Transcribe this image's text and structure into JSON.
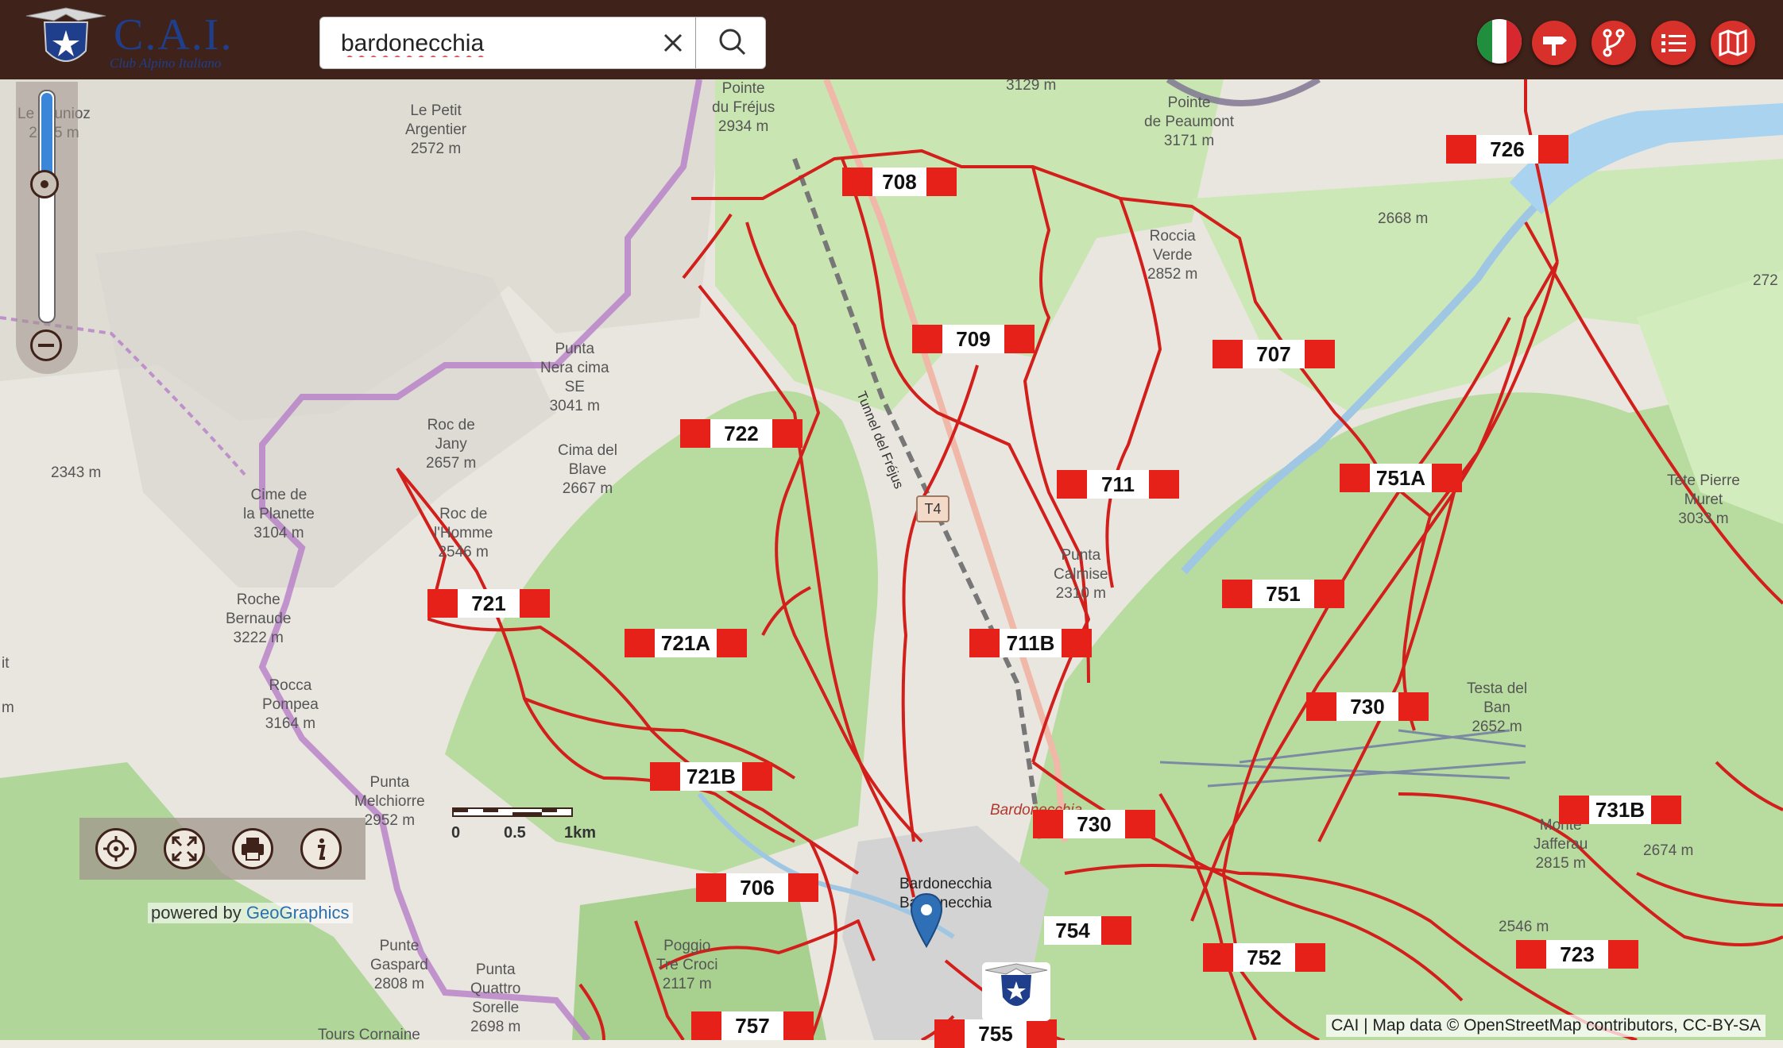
{
  "header": {
    "logo_title": "C.A.I.",
    "logo_subtitle": "Club Alpino Italiano",
    "search_value": "bardonecchia",
    "language": "it",
    "toolbar_icons": [
      "flag-italy-icon",
      "signpost-icon",
      "fork-route-icon",
      "list-icon",
      "map-icon"
    ],
    "accent": "#d8312b",
    "bar_color": "#3f2219"
  },
  "routes": [
    {
      "id": "708"
    },
    {
      "id": "726"
    },
    {
      "id": "709"
    },
    {
      "id": "707"
    },
    {
      "id": "722"
    },
    {
      "id": "711"
    },
    {
      "id": "751A"
    },
    {
      "id": "751"
    },
    {
      "id": "721"
    },
    {
      "id": "721A"
    },
    {
      "id": "711B"
    },
    {
      "id": "730"
    },
    {
      "id": "730"
    },
    {
      "id": "731B"
    },
    {
      "id": "721B"
    },
    {
      "id": "706"
    },
    {
      "id": "754"
    },
    {
      "id": "752"
    },
    {
      "id": "723"
    },
    {
      "id": "757"
    },
    {
      "id": "755"
    }
  ],
  "places": [
    "Le Jounioz\n2345 m",
    "Le Petit\nArgentier\n2572 m",
    "Pointe\ndu Fréjus\n2934 m",
    "3129 m",
    "Pointe\nde Peaumont\n3171 m",
    "Roccia\nVerde\n2852 m",
    "2668 m",
    "272",
    "Punta\nNera cima\nSE\n3041 m",
    "Roc de\nJany\n2657 m",
    "Cima del\nBlave\n2667 m",
    "2343 m",
    "Cime de\nla Planette\n3104 m",
    "Roc de\nl'Homme\n2546 m",
    "Punta\nCalmise\n2310 m",
    "Tete Pierre\nMuret\n3033 m",
    "Roche\nBernaude\n3222 m",
    "Rocca\nPompea\n3164 m",
    "Testa del\nBan\n2652 m",
    "Punta\nMelchiorre\n2952 m",
    "Monte\nJafferau\n2815 m",
    "2674 m",
    "Bardonecchia\nBardonecchia",
    "Poggio\nTre Croci\n2117 m",
    "2546 m",
    "Punte\nGaspard\n2808 m",
    "Punta\nQuattro\nSorelle\n2698 m",
    "Tours Cornaine",
    "it",
    "m"
  ],
  "tunnel_label": "Tunnel del Fréjus",
  "road_ref": "T4",
  "town_red_label": "Bardonecchia",
  "scale": {
    "labels": [
      "0",
      "0.5",
      "1km"
    ]
  },
  "map_tools": [
    "locate-icon",
    "fullscreen-icon",
    "print-icon",
    "info-icon"
  ],
  "powered_by": {
    "prefix": "powered by",
    "link": "GeoGraphics"
  },
  "attribution": "CAI | Map data © OpenStreetMap contributors, CC-BY-SA"
}
